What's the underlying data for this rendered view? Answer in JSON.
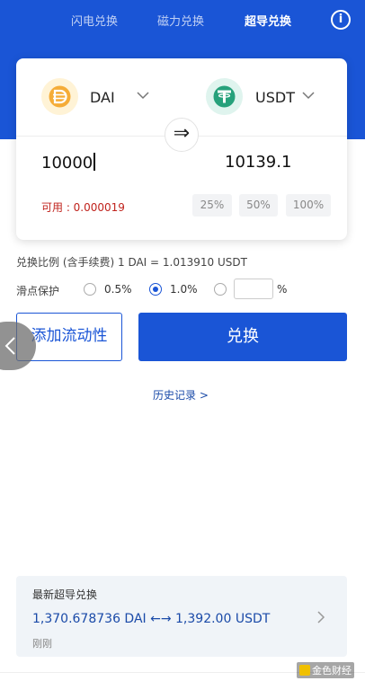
{
  "tabs": [
    "闪电兑换",
    "磁力兑换",
    "超导兑换"
  ],
  "active_tab": "超导兑换",
  "from_token": {
    "name": "DAI",
    "icon": "dai-coin-icon",
    "color": "#f5ac37",
    "amount": "10000"
  },
  "to_token": {
    "name": "USDT",
    "icon": "tether-coin-icon",
    "color": "#26a17b",
    "amount": "10139.1"
  },
  "available": "可用 : 0.000019",
  "percent_buttons": [
    "25%",
    "50%",
    "100%"
  ],
  "rate": "兑换比例 (含手续费) 1 DAI = 1.013910 USDT",
  "slippage": {
    "label": "滑点保护",
    "options": [
      "0.5%",
      "1.0%"
    ],
    "selected": "1.0%",
    "custom_value": "",
    "custom_unit": "%"
  },
  "buttons": {
    "add_liquidity": "添加流动性",
    "swap": "兑换"
  },
  "history_link": "历史记录 >",
  "latest": {
    "title": "最新超导兑换",
    "transaction": "1,370.678736 DAI ←→ 1,392.00 USDT",
    "time": "刚刚"
  },
  "watermark": "金色财经",
  "colors": {
    "primary": "#1a55d6",
    "danger": "#c0231d",
    "panel": "#f0f4f8"
  }
}
